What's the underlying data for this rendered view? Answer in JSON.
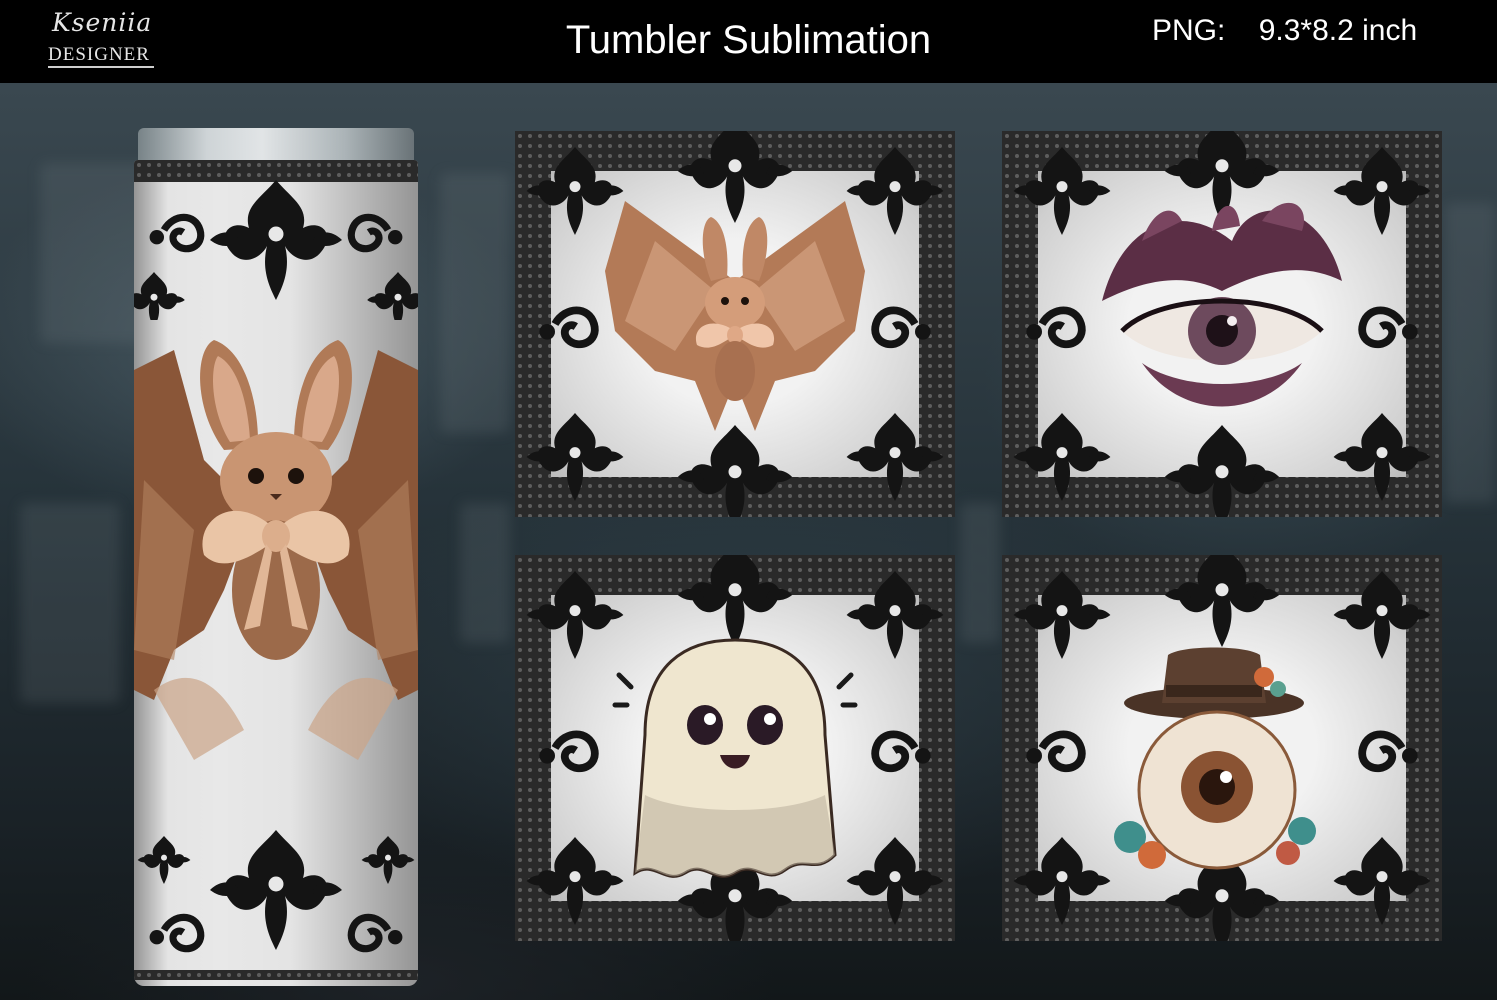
{
  "header": {
    "logo_script": "Kseniia",
    "logo_caps": "DESIGNER",
    "title": "Tumbler Sublimation",
    "format": "PNG:",
    "size": "9.3*8.2 inch"
  },
  "icons": {
    "tumbler": "bat-with-bow-tumbler-mockup",
    "card_1": "lace-bat-with-bow",
    "card_2": "feathered-eye",
    "card_3": "cute-lace-ghost",
    "card_4": "eyeball-with-top-hat"
  },
  "colors": {
    "header_bg": "#000000",
    "lace": "#141414",
    "bat_brown": "#a9704e",
    "eye_purple": "#5b2e45",
    "ghost_cream": "#efe6cf"
  }
}
